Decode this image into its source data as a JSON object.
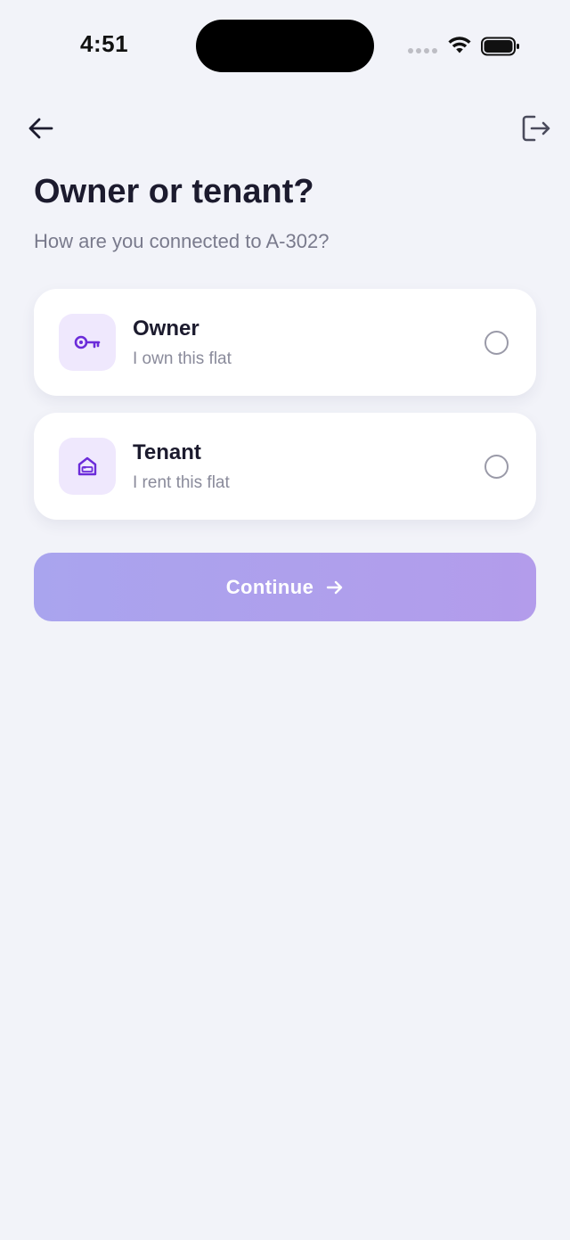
{
  "status_bar": {
    "time": "4:51"
  },
  "header": {
    "back_icon": "arrow-left-icon",
    "logout_icon": "logout-icon"
  },
  "page": {
    "title": "Owner or tenant?",
    "subtitle": "How are you connected to A-302?"
  },
  "options": [
    {
      "label": "Owner",
      "description": "I own this flat",
      "icon": "key-icon",
      "selected": false
    },
    {
      "label": "Tenant",
      "description": "I rent this flat",
      "icon": "home-icon",
      "selected": false
    }
  ],
  "continue_button": {
    "label": "Continue",
    "icon": "arrow-right-icon",
    "enabled": false
  },
  "colors": {
    "background": "#f2f3f9",
    "accent": "#6b2bd9",
    "icon_tile": "#efe8fd",
    "button_gradient_start": "#a9a4ee",
    "button_gradient_end": "#b39ceb"
  }
}
